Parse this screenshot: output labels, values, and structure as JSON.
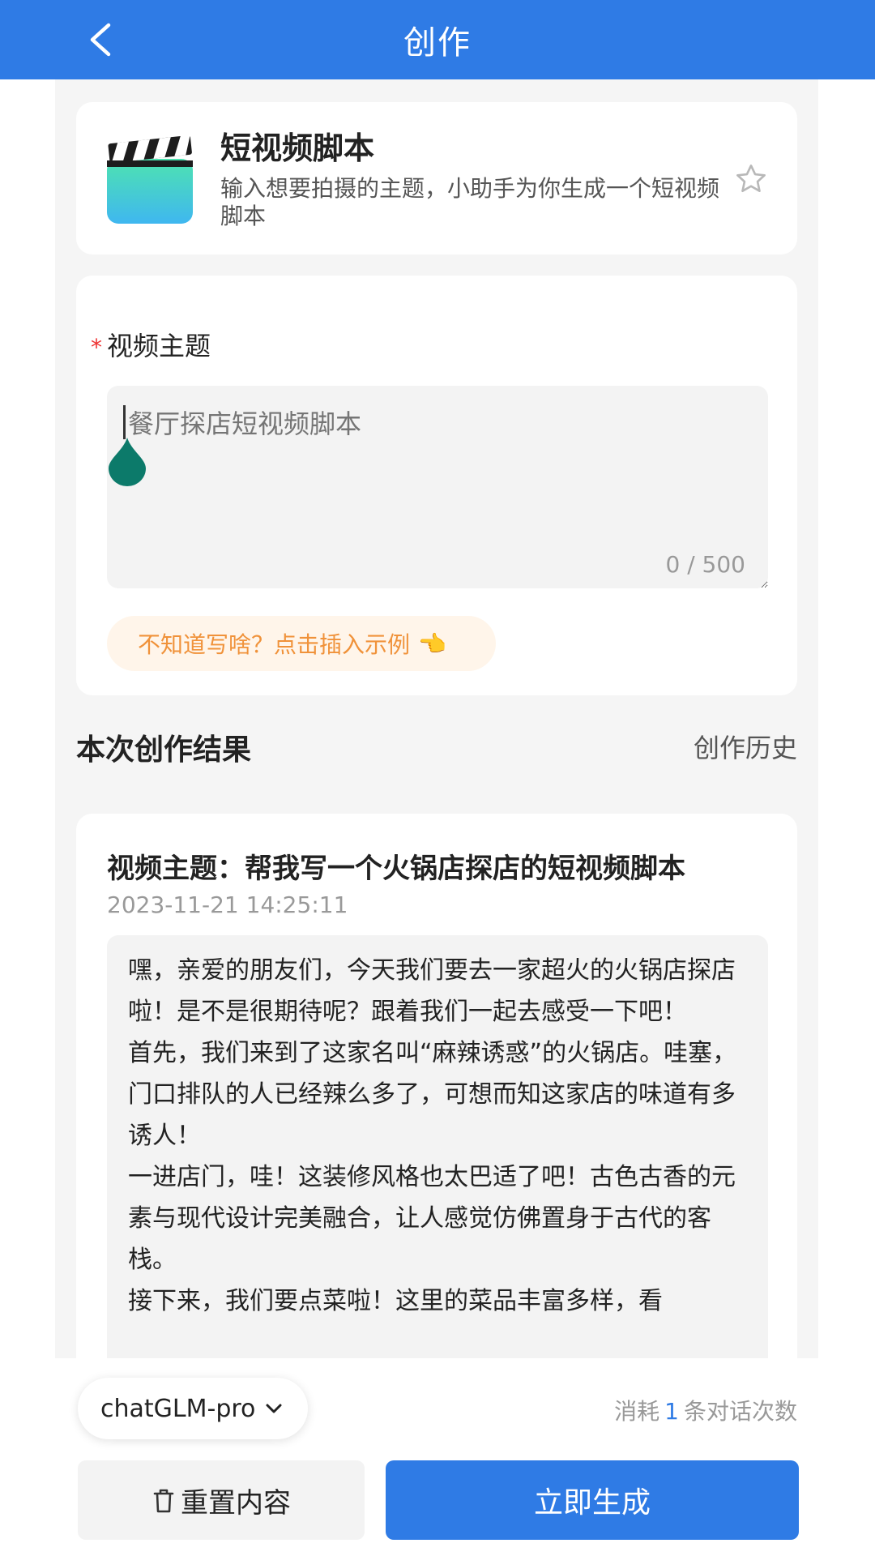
{
  "header": {
    "title": "创作"
  },
  "tool": {
    "title": "短视频脚本",
    "description": "输入想要拍摄的主题，小助手为你生成一个短视频脚本"
  },
  "form": {
    "required_mark": "*",
    "label": "视频主题",
    "placeholder": "餐厅探店短视频脚本",
    "value": "",
    "counter": "0 / 500",
    "example_label": "不知道写啥？点击插入示例",
    "example_emoji": "👈"
  },
  "results": {
    "section_title": "本次创作结果",
    "history_link": "创作历史",
    "item": {
      "title": "视频主题：帮我写一个火锅店探店的短视频脚本",
      "time": "2023-11-21 14:25:11",
      "content": "嘿，亲爱的朋友们，今天我们要去一家超火的火锅店探店啦！是不是很期待呢？跟着我们一起去感受一下吧！\n首先，我们来到了这家名叫“麻辣诱惑”的火锅店。哇塞，门口排队的人已经辣么多了，可想而知这家店的味道有多诱人！\n一进店门，哇！这装修风格也太巴适了吧！古色古香的元素与现代设计完美融合，让人感觉仿佛置身于古代的客栈。\n接下来，我们要点菜啦！这里的菜品丰富多样，看"
    }
  },
  "bottom": {
    "model": "chatGLM-pro",
    "usage_prefix": "消耗",
    "usage_count": "1",
    "usage_suffix": "条对话次数",
    "reset_label": "重置内容",
    "generate_label": "立即生成"
  },
  "colors": {
    "primary": "#2f7be5",
    "background": "#f5f5f5",
    "example_text": "#f0923a",
    "example_bg": "#fff5ea",
    "required": "#e33333",
    "caret_handle": "#0c7a6a"
  }
}
